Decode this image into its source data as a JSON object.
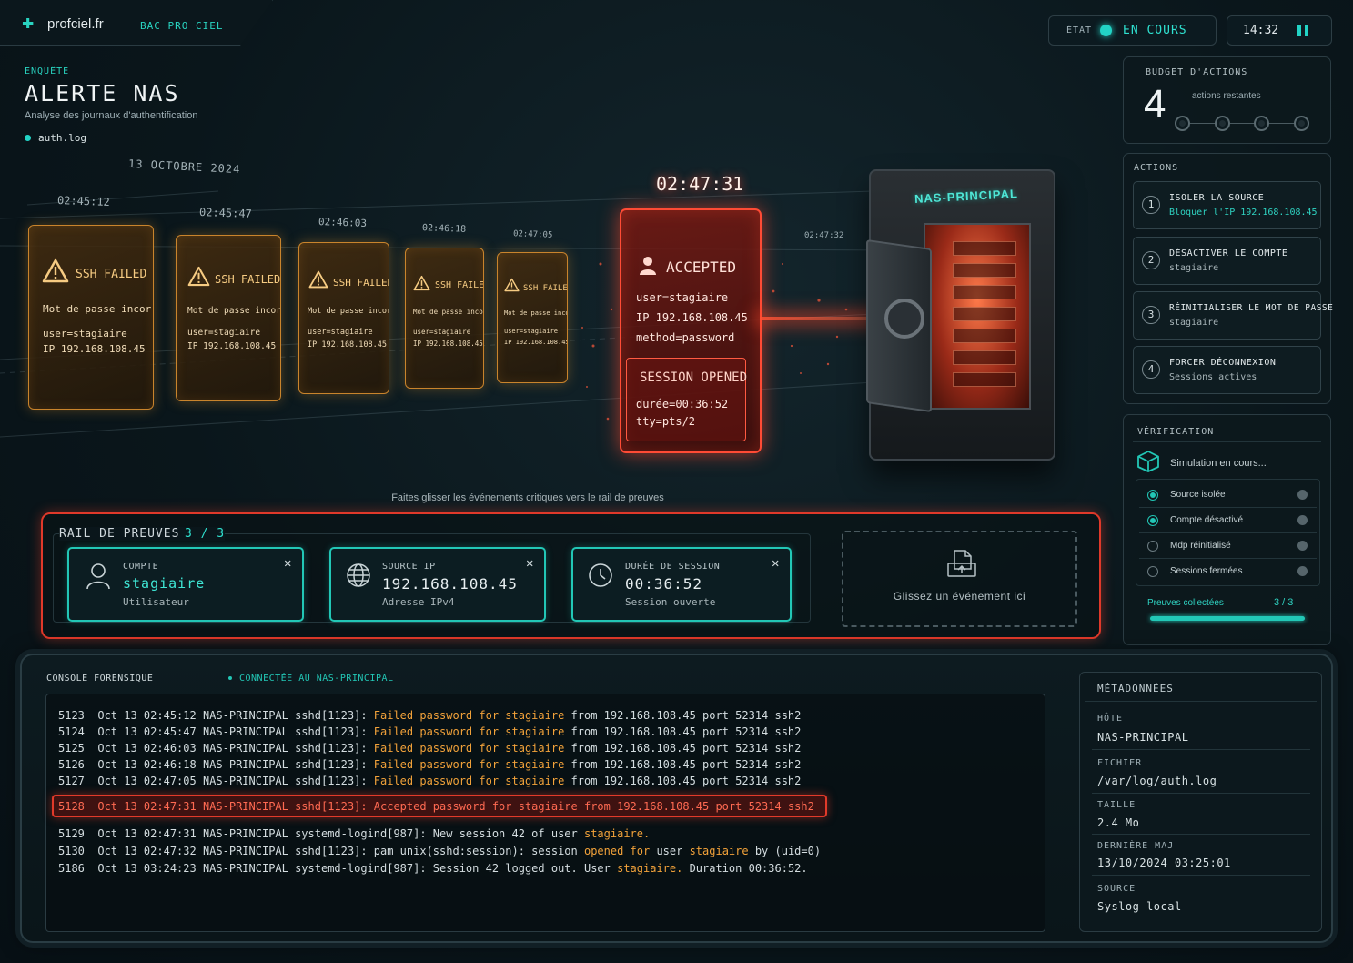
{
  "header": {
    "brand": "profciel.fr",
    "tag": "BAC PRO CIEL",
    "state_label": "ÉTAT",
    "state_value": "EN COURS",
    "clock": "14:32"
  },
  "investigation": {
    "kicker": "ENQUÊTE",
    "title": "ALERTE NAS",
    "subtitle": "Analyse des journaux d'authentification",
    "file": "auth.log"
  },
  "timeline": {
    "date": "13 OCTOBRE 2024",
    "failed_events": [
      {
        "time": "02:45:12",
        "title": "SSH FAILED",
        "reason": "Mot de passe incorrect",
        "user": "user=stagiaire",
        "ip": "IP 192.168.108.45"
      },
      {
        "time": "02:45:47",
        "title": "SSH FAILED",
        "reason": "Mot de passe incorrect",
        "user": "user=stagiaire",
        "ip": "IP 192.168.108.45"
      },
      {
        "time": "02:46:03",
        "title": "SSH FAILED",
        "reason": "Mot de passe incorrect",
        "user": "user=stagiaire",
        "ip": "IP 192.168.108.45"
      },
      {
        "time": "02:46:18",
        "title": "SSH FAILED",
        "reason": "Mot de passe incorrect",
        "user": "user=stagiaire",
        "ip": "IP 192.168.108.45"
      },
      {
        "time": "02:47:05",
        "title": "SSH FAILED",
        "reason": "Mot de passe incorrect",
        "user": "user=stagiaire",
        "ip": "IP 192.168.108.45"
      }
    ],
    "accepted": {
      "time": "02:47:31",
      "title": "ACCEPTED",
      "user": "user=stagiaire",
      "ip": "IP 192.168.108.45",
      "method": "method=password",
      "session_title": "SESSION OPENED",
      "duration": "durée=00:36:52",
      "tty": "tty=pts/2"
    },
    "beam_time": "02:47:32",
    "target": "NAS-PRINCIPAL",
    "hint": "Faites glisser les événements critiques vers le rail de preuves"
  },
  "evidence_rail": {
    "title": "RAIL DE PREUVES",
    "count": "3 / 3",
    "cards": [
      {
        "label": "COMPTE",
        "value": "stagiaire",
        "sub": "Utilisateur",
        "icon": "user-icon"
      },
      {
        "label": "SOURCE IP",
        "value": "192.168.108.45",
        "sub": "Adresse IPv4",
        "icon": "globe-icon"
      },
      {
        "label": "DURÉE DE SESSION",
        "value": "00:36:52",
        "sub": "Session ouverte",
        "icon": "clock-icon"
      }
    ],
    "drop_text": "Glissez un événement ici"
  },
  "budget": {
    "title": "BUDGET D'ACTIONS",
    "count": "4",
    "sub": "actions restantes"
  },
  "actions": {
    "title": "ACTIONS",
    "items": [
      {
        "num": "1",
        "title": "ISOLER LA SOURCE",
        "sub": "Bloquer l'IP 192.168.108.45"
      },
      {
        "num": "2",
        "title": "DÉSACTIVER LE COMPTE",
        "sub": "stagiaire"
      },
      {
        "num": "3",
        "title": "RÉINITIALISER LE MOT DE PASSE",
        "sub": "stagiaire"
      },
      {
        "num": "4",
        "title": "FORCER DÉCONNEXION",
        "sub": "Sessions actives"
      }
    ]
  },
  "verification": {
    "title": "VÉRIFICATION",
    "status": "Simulation en cours...",
    "checks": [
      "Source isolée",
      "Compte désactivé",
      "Mdp réinitialisé",
      "Sessions fermées"
    ],
    "evidence_label": "Preuves collectées",
    "evidence_count": "3 / 3",
    "evidence_progress": 1.0
  },
  "console": {
    "title": "CONSOLE FORENSIQUE",
    "status": "CONNECTÉE AU NAS-PRINCIPAL",
    "failed_lines": [
      "5123  Oct 13 02:45:12 NAS-PRINCIPAL sshd[1123]: ",
      "5124  Oct 13 02:45:47 NAS-PRINCIPAL sshd[1123]: ",
      "5125  Oct 13 02:46:03 NAS-PRINCIPAL sshd[1123]: ",
      "5126  Oct 13 02:46:18 NAS-PRINCIPAL sshd[1123]: ",
      "5127  Oct 13 02:47:05 NAS-PRINCIPAL sshd[1123]: "
    ],
    "failed_msg": "Failed password for stagiaire",
    "failed_tail": " from 192.168.108.45 port 52314 ssh2",
    "highlight": "5128  Oct 13 02:47:31 NAS-PRINCIPAL sshd[1123]: Accepted password for stagiaire from 192.168.108.45 port 52314 ssh2",
    "line_5129_a": "5129  Oct 13 02:47:31 NAS-PRINCIPAL systemd-logind[987]: New session 42 of user ",
    "line_5129_b": "stagiaire.",
    "line_5130_a": "5130  Oct 13 02:47:32 NAS-PRINCIPAL sshd[1123]: pam_unix(sshd:session): session ",
    "line_5130_b": "opened for",
    "line_5130_c": " user ",
    "line_5130_d": "stagiaire",
    "line_5130_e": " by (uid=0)",
    "line_5186_a": "5186  Oct 13 03:24:23 NAS-PRINCIPAL systemd-logind[987]: Session 42 logged out. User ",
    "line_5186_b": "stagiaire.",
    "line_5186_c": " Duration 00:36:52."
  },
  "metadata": {
    "title": "MÉTADONNÉES",
    "host_label": "HÔTE",
    "host": "NAS-PRINCIPAL",
    "file_label": "FICHIER",
    "file": "/var/log/auth.log",
    "size_label": "TAILLE",
    "size": "2.4 Mo",
    "updated_label": "DERNIÈRE MAJ",
    "updated": "13/10/2024 03:25:01",
    "source_label": "SOURCE",
    "source": "Syslog local"
  },
  "colors": {
    "accent": "#22d3c5",
    "alert": "#ff4b35",
    "warning": "#e69a2e"
  }
}
